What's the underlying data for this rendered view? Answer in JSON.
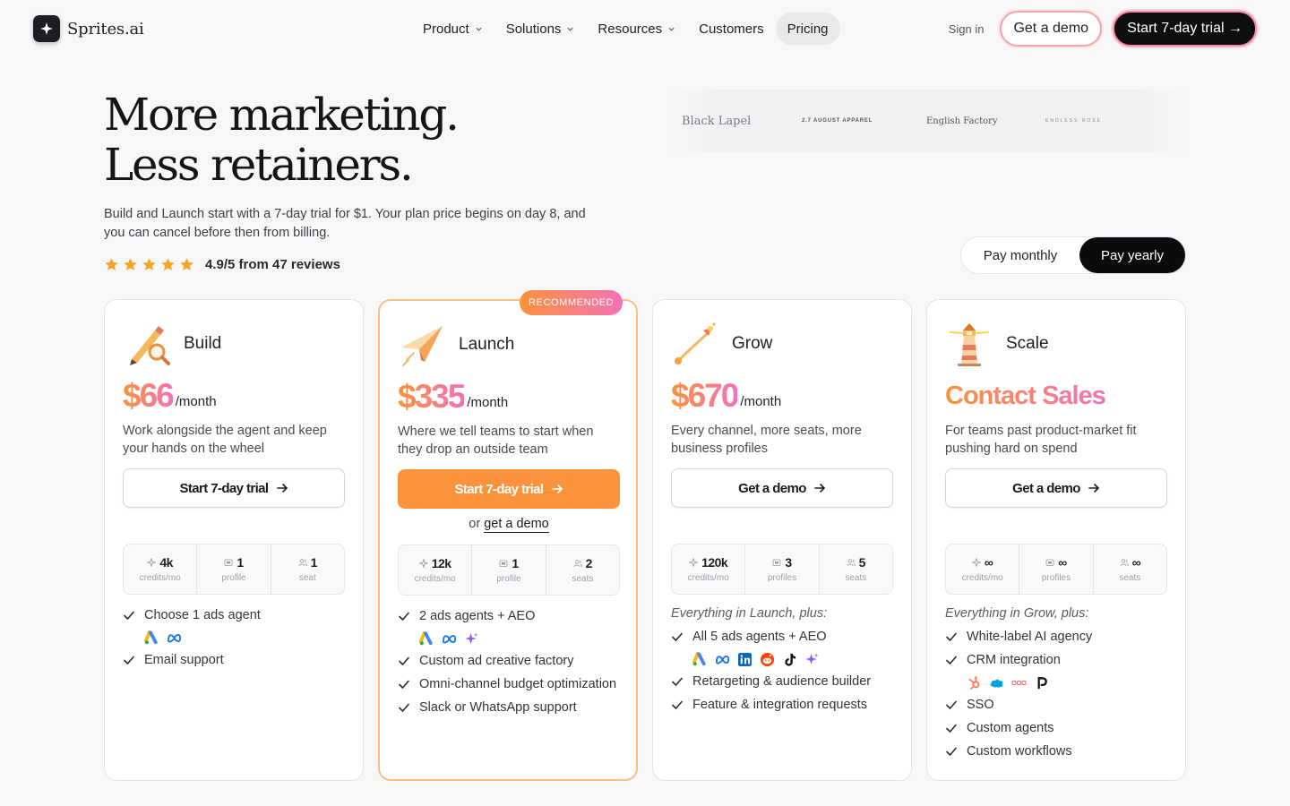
{
  "brand": {
    "name": "Sprites.ai"
  },
  "nav": {
    "items": [
      {
        "label": "Product",
        "dropdown": true
      },
      {
        "label": "Solutions",
        "dropdown": true
      },
      {
        "label": "Resources",
        "dropdown": true
      },
      {
        "label": "Customers",
        "dropdown": false
      },
      {
        "label": "Pricing",
        "dropdown": false,
        "active": true
      }
    ],
    "signin": "Sign in",
    "demo": "Get a demo",
    "trial": "Start 7-day trial →"
  },
  "hero": {
    "title_line1": "More marketing.",
    "title_line2": "Less retainers.",
    "subtitle": "Build and Launch start with a 7-day trial for $1. Your plan price begins on day 8, and you can cancel before then from billing.",
    "rating": 4.9,
    "reviews_text": "4.9/5 from 47 reviews"
  },
  "logos": [
    "Black Lapel",
    "2.7 AUGUST APPAREL",
    "English Factory",
    "ENDLESS ROSE"
  ],
  "billing_toggle": {
    "monthly": "Pay monthly",
    "yearly": "Pay yearly",
    "selected": "yearly"
  },
  "colors": {
    "accent_orange": "#fb923c",
    "accent_pink": "#f472b6",
    "dark": "#0e0e10"
  },
  "plans": [
    {
      "name": "Build",
      "icon": "magnifier-pencil-icon",
      "price": "$66",
      "period": "/month",
      "description": "Work alongside the agent and keep your hands on the wheel",
      "cta": "Start 7-day trial",
      "stats": [
        {
          "value": "4k",
          "label": "credits/mo"
        },
        {
          "value": "1",
          "label": "profile"
        },
        {
          "value": "1",
          "label": "seat"
        }
      ],
      "features": [
        "Choose 1 ads agent",
        "Email support"
      ]
    },
    {
      "name": "Launch",
      "icon": "paper-plane-icon",
      "badge": "RECOMMENDED",
      "price": "$335",
      "period": "/month",
      "description": "Where we tell teams to start when they drop an outside team",
      "cta": "Start 7-day trial",
      "or_text": "or",
      "or_link": "get a demo",
      "stats": [
        {
          "value": "12k",
          "label": "credits/mo"
        },
        {
          "value": "1",
          "label": "profile"
        },
        {
          "value": "2",
          "label": "seats"
        }
      ],
      "features": [
        "2 ads agents + AEO",
        "Custom ad creative factory",
        "Omni-channel budget optimization",
        "Slack or WhatsApp support"
      ]
    },
    {
      "name": "Grow",
      "icon": "rocket-icon",
      "price": "$670",
      "period": "/month",
      "description": "Every channel, more seats, more business profiles",
      "cta": "Get a demo",
      "stats": [
        {
          "value": "120k",
          "label": "credits/mo"
        },
        {
          "value": "3",
          "label": "profiles"
        },
        {
          "value": "5",
          "label": "seats"
        }
      ],
      "plus": "Everything in Launch, plus:",
      "features": [
        "All 5 ads agents + AEO",
        "Retargeting & audience builder",
        "Feature & integration requests"
      ]
    },
    {
      "name": "Scale",
      "icon": "lighthouse-icon",
      "price": "Contact Sales",
      "period": "",
      "description": "For teams past product-market fit pushing hard on spend",
      "cta": "Get a demo",
      "stats": [
        {
          "value": "∞",
          "label": "credits/mo"
        },
        {
          "value": "∞",
          "label": "profiles"
        },
        {
          "value": "∞",
          "label": "seats"
        }
      ],
      "plus": "Everything in Grow, plus:",
      "features": [
        "White-label AI agency",
        "CRM integration",
        "SSO",
        "Custom agents",
        "Custom workflows"
      ]
    }
  ]
}
